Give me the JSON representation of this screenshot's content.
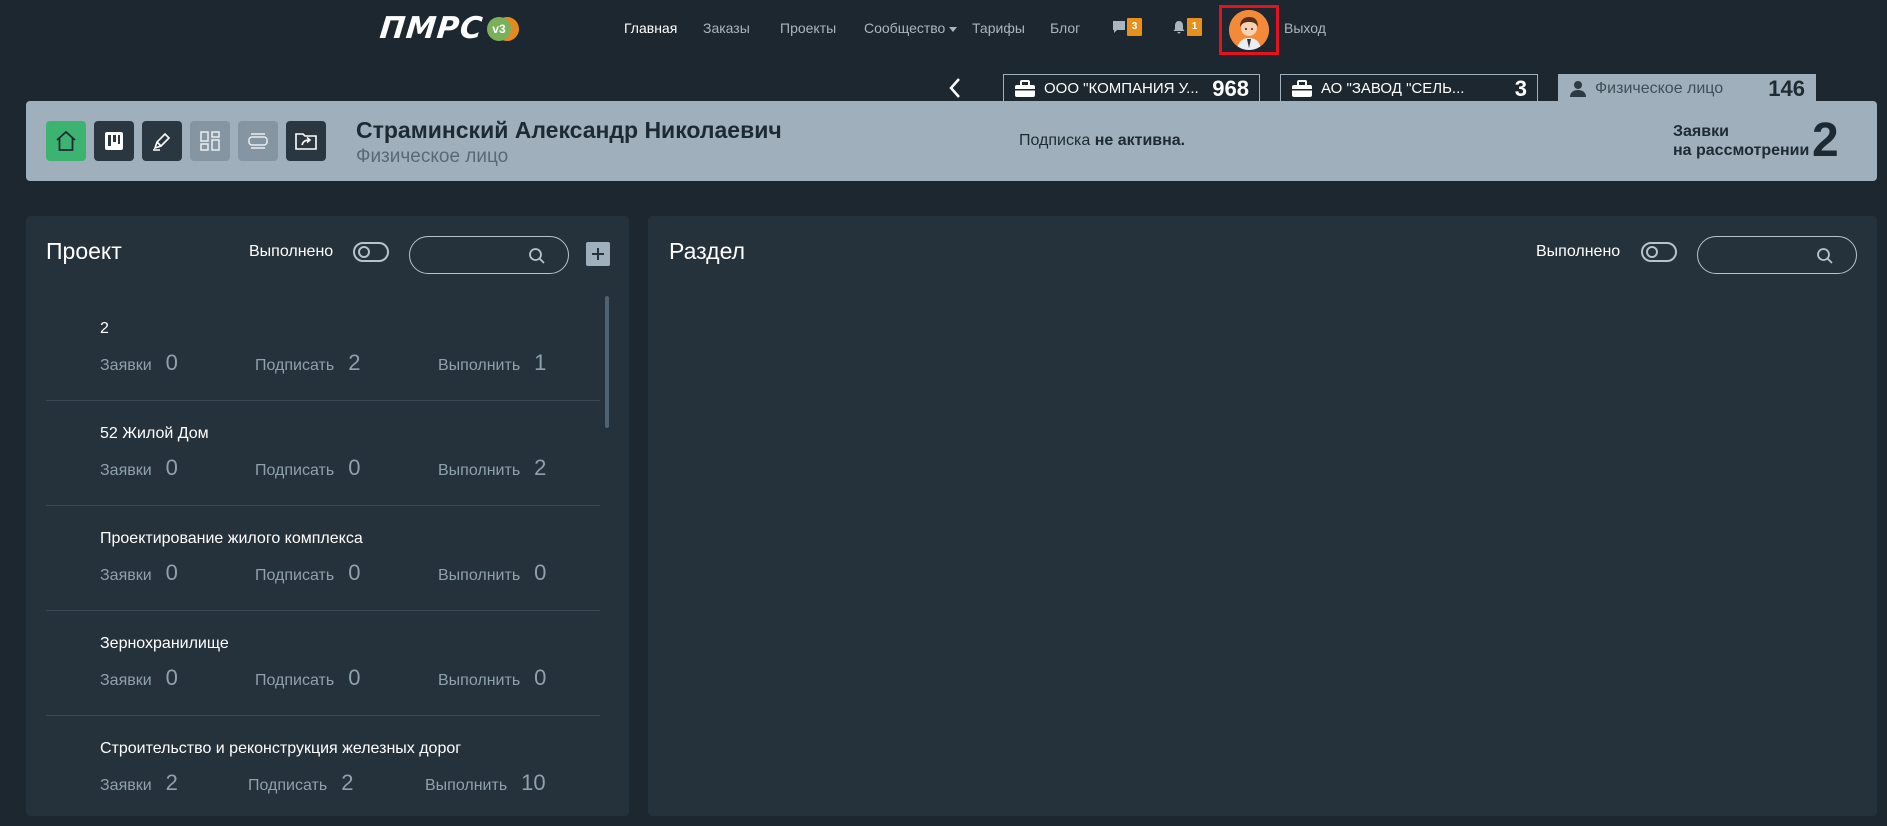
{
  "logo": {
    "text": "ПМРС",
    "version": "v3"
  },
  "nav": {
    "home": "Главная",
    "orders": "Заказы",
    "projects": "Проекты",
    "community": "Сообщество",
    "tariffs": "Тарифы",
    "blog": "Блог",
    "messages_count": "3",
    "notifications_count": "1",
    "logout": "Выход"
  },
  "org_tabs": [
    {
      "name": "ООО \"КОМПАНИЯ У...",
      "count": "968"
    },
    {
      "name": "АО \"ЗАВОД \"СЕЛЬ...",
      "count": "3"
    },
    {
      "name": "Физическое лицо",
      "count": "146"
    }
  ],
  "profile": {
    "name": "Страминский Александр Николаевич",
    "type": "Физическое лицо",
    "subscription_prefix": "Подписка",
    "subscription_status": "не активна.",
    "requests_label_1": "Заявки",
    "requests_label_2": "на рассмотрении",
    "requests_count": "2"
  },
  "project_panel": {
    "title": "Проект",
    "done_label": "Выполнено",
    "search_value": "",
    "items": [
      {
        "name": "2",
        "requests_label": "Заявки",
        "requests": "0",
        "sign_label": "Подписать",
        "sign": "2",
        "execute_label": "Выполнить",
        "execute": "1"
      },
      {
        "name": "52 Жилой Дом",
        "requests_label": "Заявки",
        "requests": "0",
        "sign_label": "Подписать",
        "sign": "0",
        "execute_label": "Выполнить",
        "execute": "2"
      },
      {
        "name": "Проектирование жилого комплекса",
        "requests_label": "Заявки",
        "requests": "0",
        "sign_label": "Подписать",
        "sign": "0",
        "execute_label": "Выполнить",
        "execute": "0"
      },
      {
        "name": "Зернохранилище",
        "requests_label": "Заявки",
        "requests": "0",
        "sign_label": "Подписать",
        "sign": "0",
        "execute_label": "Выполнить",
        "execute": "0"
      },
      {
        "name": "Строительство и реконструкция железных дорог",
        "requests_label": "Заявки",
        "requests": "2",
        "sign_label": "Подписать",
        "sign": "2",
        "execute_label": "Выполнить",
        "execute": "10"
      }
    ]
  },
  "section_panel": {
    "title": "Раздел",
    "done_label": "Выполнено",
    "search_value": ""
  },
  "colors": {
    "background": "#1c272f",
    "panel": "#25313b",
    "header_band": "#9fb0bc",
    "accent_green": "#3cb371",
    "badge_orange": "#e8901e",
    "highlight_red": "#e5111f"
  }
}
